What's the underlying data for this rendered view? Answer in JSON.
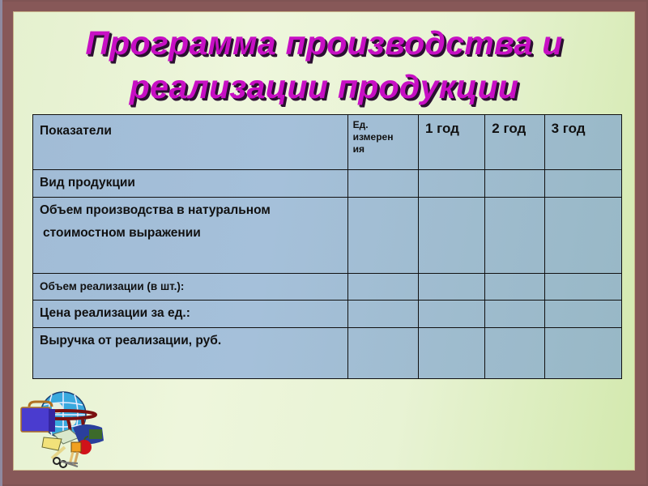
{
  "slide": {
    "title_line1": "Программа производства и",
    "title_line2": "реализации продукции",
    "colors": {
      "title": "#c70fc4",
      "frame": "#875858",
      "panel": "#e8f3d4",
      "table_fill": "#a1bcd6"
    }
  },
  "table": {
    "headers": {
      "indicator": "Показатели",
      "unit": "Ед. измерения",
      "year1": "1 год",
      "year2": "2 год",
      "year3": "3 год"
    },
    "rows": [
      {
        "label": "Вид продукции",
        "unit": "",
        "y1": "",
        "y2": "",
        "y3": ""
      },
      {
        "label_line1": "Объем производства в натуральном",
        "label_line2": "стоимостном выражении",
        "unit": "",
        "y1": "",
        "y2": "",
        "y3": ""
      },
      {
        "label": "Объем реализации (в шт.):",
        "unit": "",
        "y1": "",
        "y2": "",
        "y3": ""
      },
      {
        "label": "Цена реализации за ед.:",
        "unit": "",
        "y1": "",
        "y2": "",
        "y3": ""
      },
      {
        "label": "Выручка от реализации, руб.",
        "unit": "",
        "y1": "",
        "y2": "",
        "y3": ""
      }
    ]
  },
  "illustration": {
    "icon": "school-supplies-globe-icon"
  }
}
